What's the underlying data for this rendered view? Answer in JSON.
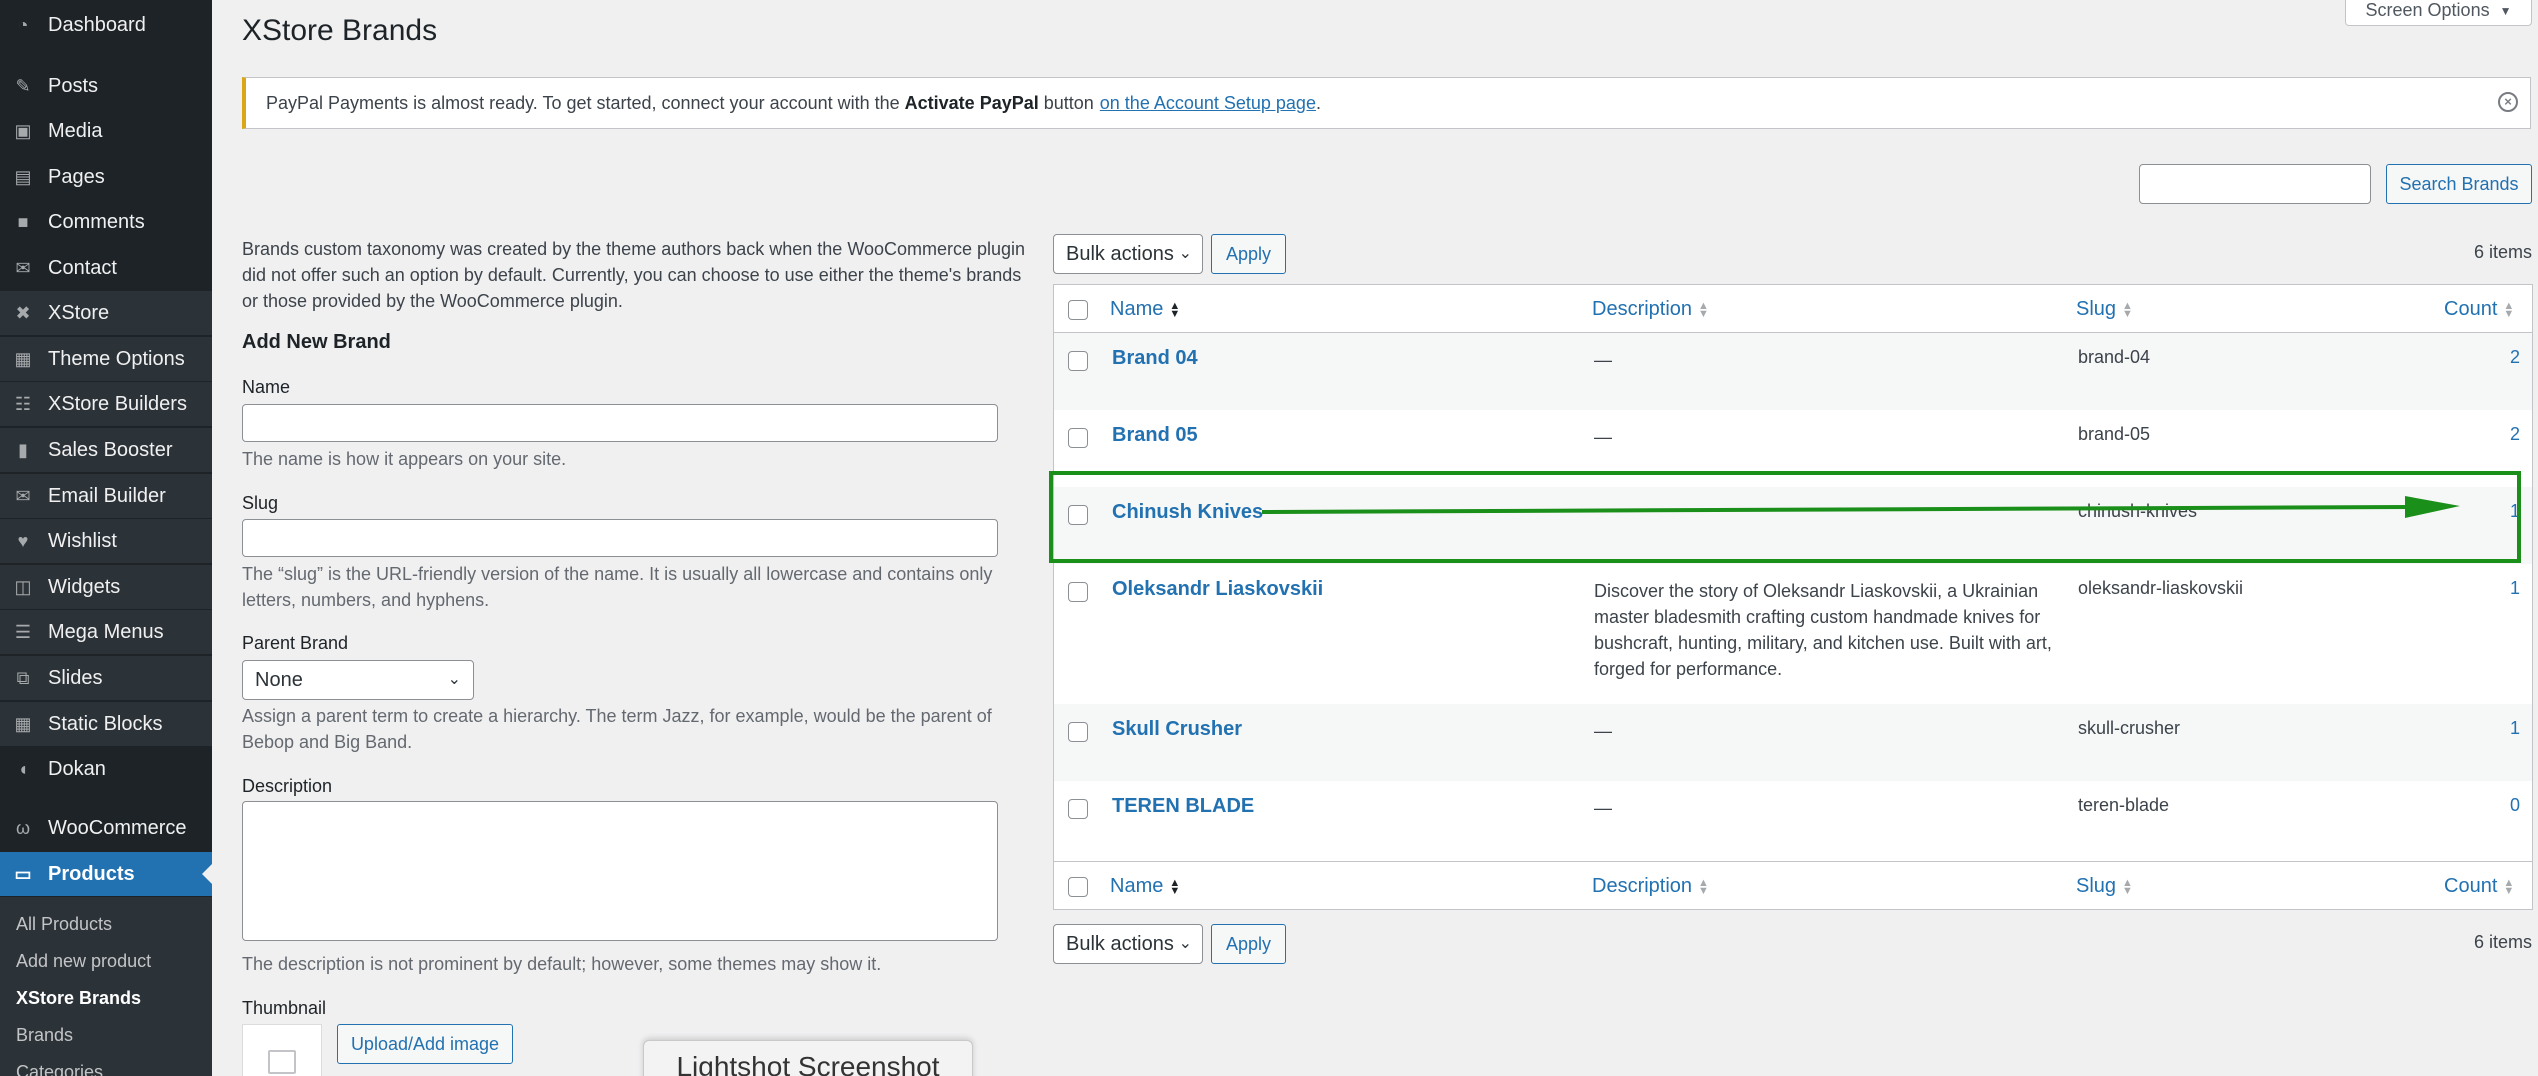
{
  "sidebar": {
    "items": [
      {
        "label": "Dashboard",
        "icon": "dashboard-icon"
      },
      {
        "label": "Posts",
        "icon": "pin-icon"
      },
      {
        "label": "Media",
        "icon": "media-icon"
      },
      {
        "label": "Pages",
        "icon": "pages-icon"
      },
      {
        "label": "Comments",
        "icon": "comments-icon"
      },
      {
        "label": "Contact",
        "icon": "mail-icon"
      },
      {
        "label": "XStore",
        "icon": "xstore-icon"
      },
      {
        "label": "Theme Options",
        "icon": "theme-options-icon"
      },
      {
        "label": "XStore Builders",
        "icon": "builders-icon"
      },
      {
        "label": "Sales Booster",
        "icon": "chart-icon"
      },
      {
        "label": "Email Builder",
        "icon": "email-icon"
      },
      {
        "label": "Wishlist",
        "icon": "heart-icon"
      },
      {
        "label": "Widgets",
        "icon": "widgets-icon"
      },
      {
        "label": "Mega Menus",
        "icon": "mega-menu-icon"
      },
      {
        "label": "Slides",
        "icon": "slides-icon"
      },
      {
        "label": "Static Blocks",
        "icon": "blocks-icon"
      },
      {
        "label": "Dokan",
        "icon": "dokan-icon"
      },
      {
        "label": "WooCommerce",
        "icon": "woocommerce-icon"
      },
      {
        "label": "Products",
        "icon": "products-icon"
      }
    ],
    "submenu": [
      "All Products",
      "Add new product",
      "XStore Brands",
      "Brands",
      "Categories"
    ]
  },
  "header": {
    "title": "XStore Brands",
    "screen_options": "Screen Options"
  },
  "notice": {
    "text1": "PayPal Payments is almost ready. To get started, connect your account with the",
    "bold": "Activate PayPal",
    "text2": "button",
    "link": "on the Account Setup page",
    "period": "."
  },
  "search": {
    "button": "Search Brands",
    "value": ""
  },
  "form": {
    "intro": "Brands custom taxonomy was created by the theme authors back when the WooCommerce plugin did not offer such an option by default. Currently, you can choose to use either the theme's brands or those provided by the WooCommerce plugin.",
    "title": "Add New Brand",
    "name_label": "Name",
    "name_help": "The name is how it appears on your site.",
    "slug_label": "Slug",
    "slug_help": "The “slug” is the URL-friendly version of the name. It is usually all lowercase and contains only letters, numbers, and hyphens.",
    "parent_label": "Parent Brand",
    "parent_value": "None",
    "parent_help": "Assign a parent term to create a hierarchy. The term Jazz, for example, would be the parent of Bebop and Big Band.",
    "desc_label": "Description",
    "desc_help": "The description is not prominent by default; however, some themes may show it.",
    "thumb_label": "Thumbnail",
    "upload_button": "Upload/Add image"
  },
  "table": {
    "bulk_actions": "Bulk actions",
    "apply": "Apply",
    "items_count": "6 items",
    "columns": {
      "name": "Name",
      "description": "Description",
      "slug": "Slug",
      "count": "Count"
    },
    "rows": [
      {
        "name": "Brand 04",
        "description": "—",
        "slug": "brand-04",
        "count": "2"
      },
      {
        "name": "Brand 05",
        "description": "—",
        "slug": "brand-05",
        "count": "2"
      },
      {
        "name": "Chinush Knives",
        "description": "",
        "slug": "chinush-knives",
        "count": "1"
      },
      {
        "name": "Oleksandr Liaskovskii",
        "description": "Discover the story of Oleksandr Liaskovskii, a Ukrainian master bladesmith crafting custom handmade knives for bushcraft, hunting, military, and kitchen use. Built with art, forged for performance.",
        "slug": "oleksandr-liaskovskii",
        "count": "1"
      },
      {
        "name": "Skull Crusher",
        "description": "—",
        "slug": "skull-crusher",
        "count": "1"
      },
      {
        "name": "TEREN BLADE",
        "description": "—",
        "slug": "teren-blade",
        "count": "0"
      }
    ]
  },
  "overlay": {
    "lightshot": "Lightshot Screenshot",
    "highlight_color": "#1a8f1a"
  }
}
